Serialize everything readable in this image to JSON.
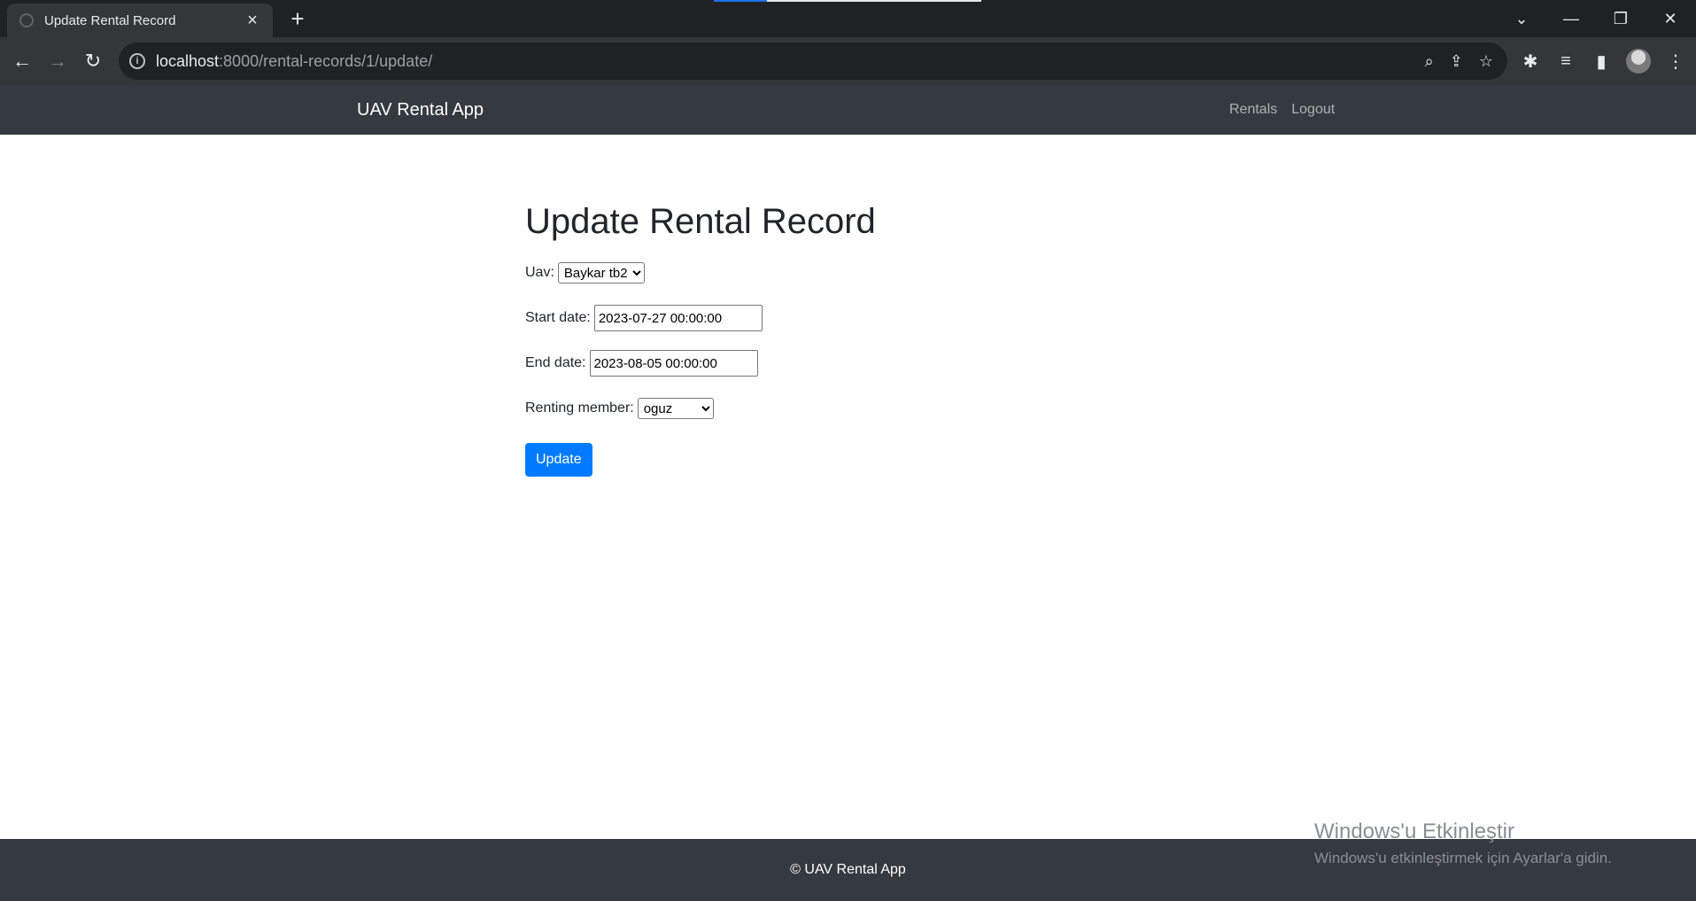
{
  "browser": {
    "tab_title": "Update Rental Record",
    "new_tab_icon": "plus-icon",
    "url_host": "localhost",
    "url_path": ":8000/rental-records/1/update/",
    "icons": {
      "back": "arrow-left-icon",
      "forward": "arrow-right-icon",
      "reload": "reload-icon",
      "zoom": "zoom-icon",
      "share": "share-icon",
      "bookmark": "star-icon",
      "extensions": "puzzle-icon",
      "media": "media-control-icon",
      "side_panel": "side-panel-icon",
      "profile": "avatar",
      "menu": "kebab-menu-icon"
    }
  },
  "navbar": {
    "brand": "UAV Rental App",
    "links": [
      "Rentals",
      "Logout"
    ]
  },
  "form": {
    "heading": "Update Rental Record",
    "uav_label": "Uav:",
    "uav_value": "Baykar tb2",
    "start_label": "Start date:",
    "start_value": "2023-07-27 00:00:00",
    "end_label": "End date:",
    "end_value": "2023-08-05 00:00:00",
    "member_label": "Renting member:",
    "member_value": "oguz",
    "submit_label": "Update"
  },
  "footer": {
    "text": "© UAV Rental App"
  },
  "watermark": {
    "line1": "Windows'u Etkinleştir",
    "line2": "Windows'u etkinleştirmek için Ayarlar'a gidin."
  },
  "colors": {
    "navbar_bg": "#343a40",
    "primary_button": "#007bff",
    "browser_frame": "#202124",
    "browser_toolbar": "#35363a"
  }
}
